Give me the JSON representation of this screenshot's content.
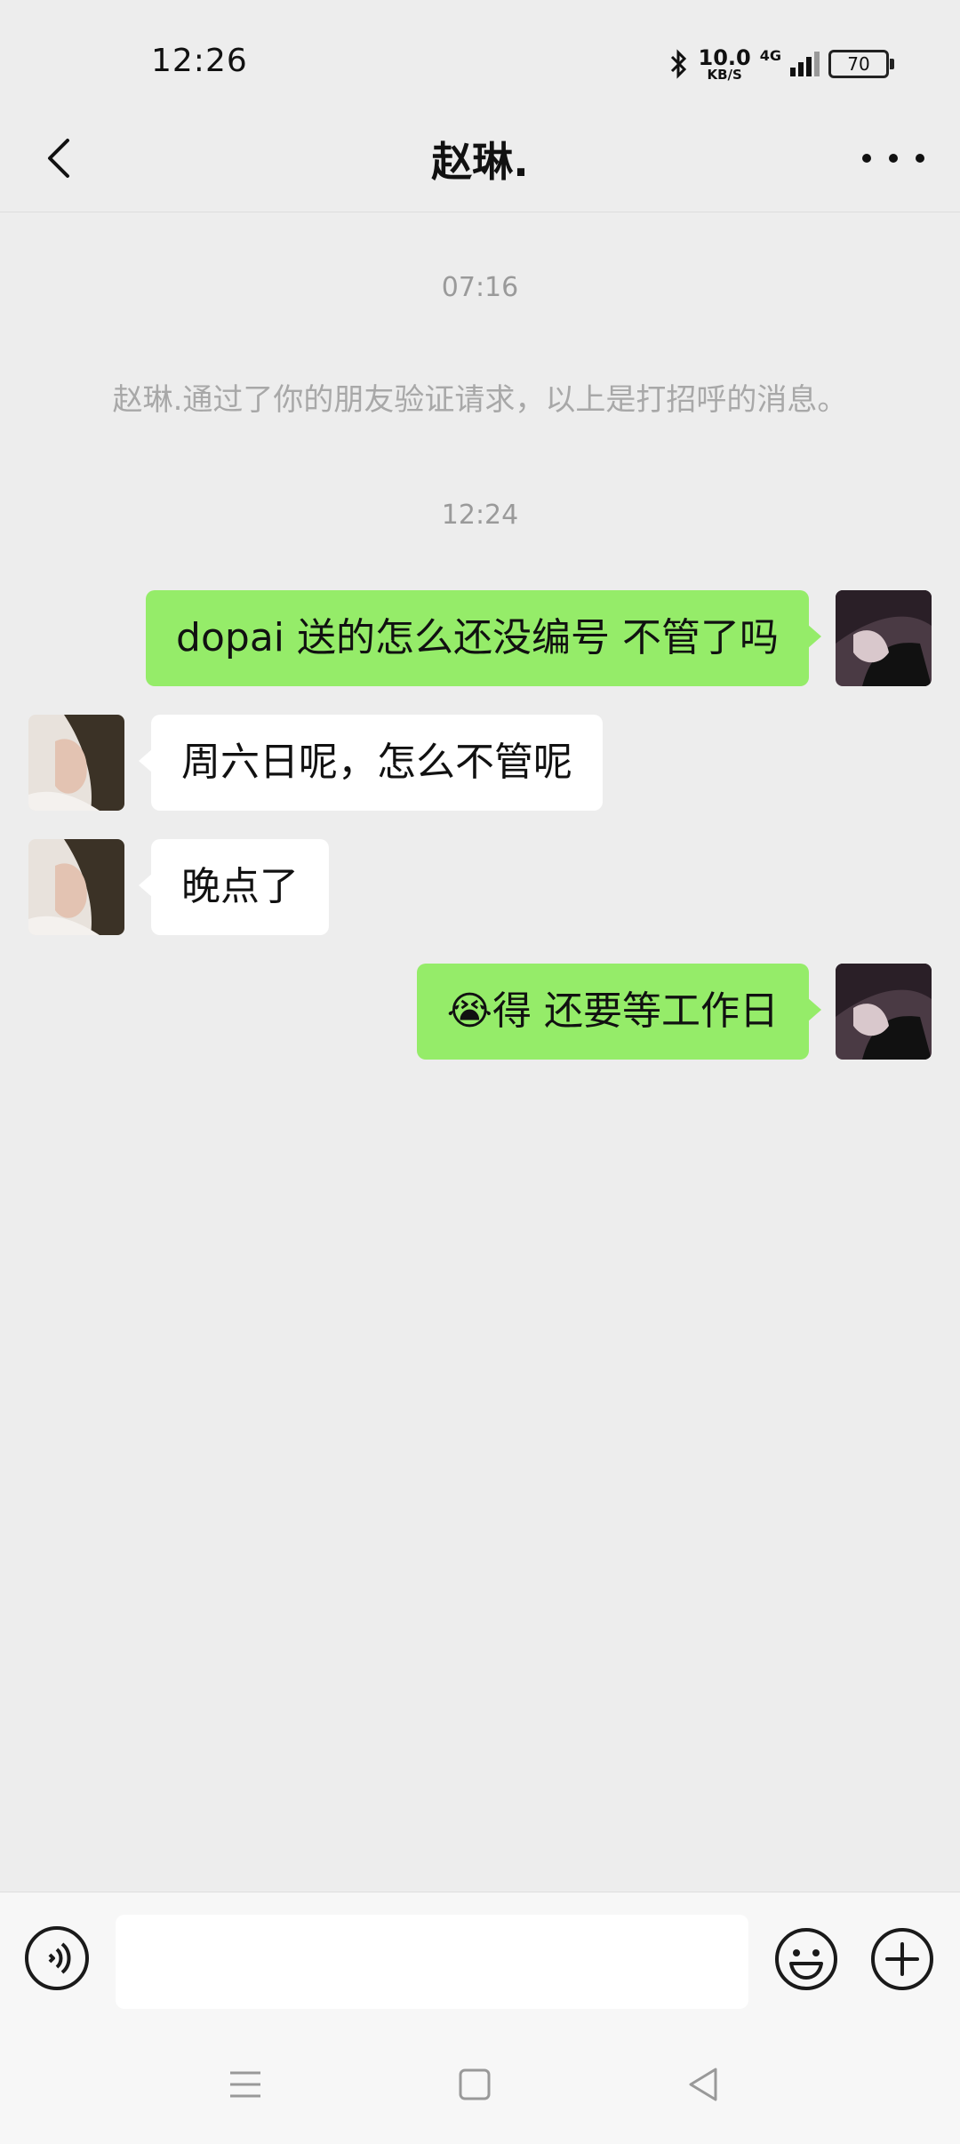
{
  "status_bar": {
    "time": "12:26",
    "net_speed_value": "10.0",
    "net_speed_unit": "KB/S",
    "network_type": "4G",
    "battery": "70"
  },
  "header": {
    "title": "赵琳."
  },
  "chat": {
    "timestamp_1": "07:16",
    "system_message": "赵琳.通过了你的朋友验证请求，以上是打招呼的消息。",
    "timestamp_2": "12:24",
    "messages": [
      {
        "from": "me",
        "text": "dopai 送的怎么还没编号  不管了吗"
      },
      {
        "from": "contact",
        "text": "周六日呢，怎么不管呢"
      },
      {
        "from": "contact",
        "text": "晚点了"
      },
      {
        "from": "me",
        "text": "😭得 还要等工作日"
      }
    ]
  },
  "input_bar": {
    "value": "",
    "placeholder": ""
  },
  "icons": {
    "back": "chevron-left-icon",
    "more": "more-dots-icon",
    "voice": "voice-input-icon",
    "emoji": "emoji-icon",
    "plus": "plus-icon",
    "bluetooth": "bluetooth-icon"
  },
  "colors": {
    "background": "#ededed",
    "my_bubble": "#95ec69",
    "their_bubble": "#ffffff",
    "meta_text": "#9a9a9a"
  }
}
